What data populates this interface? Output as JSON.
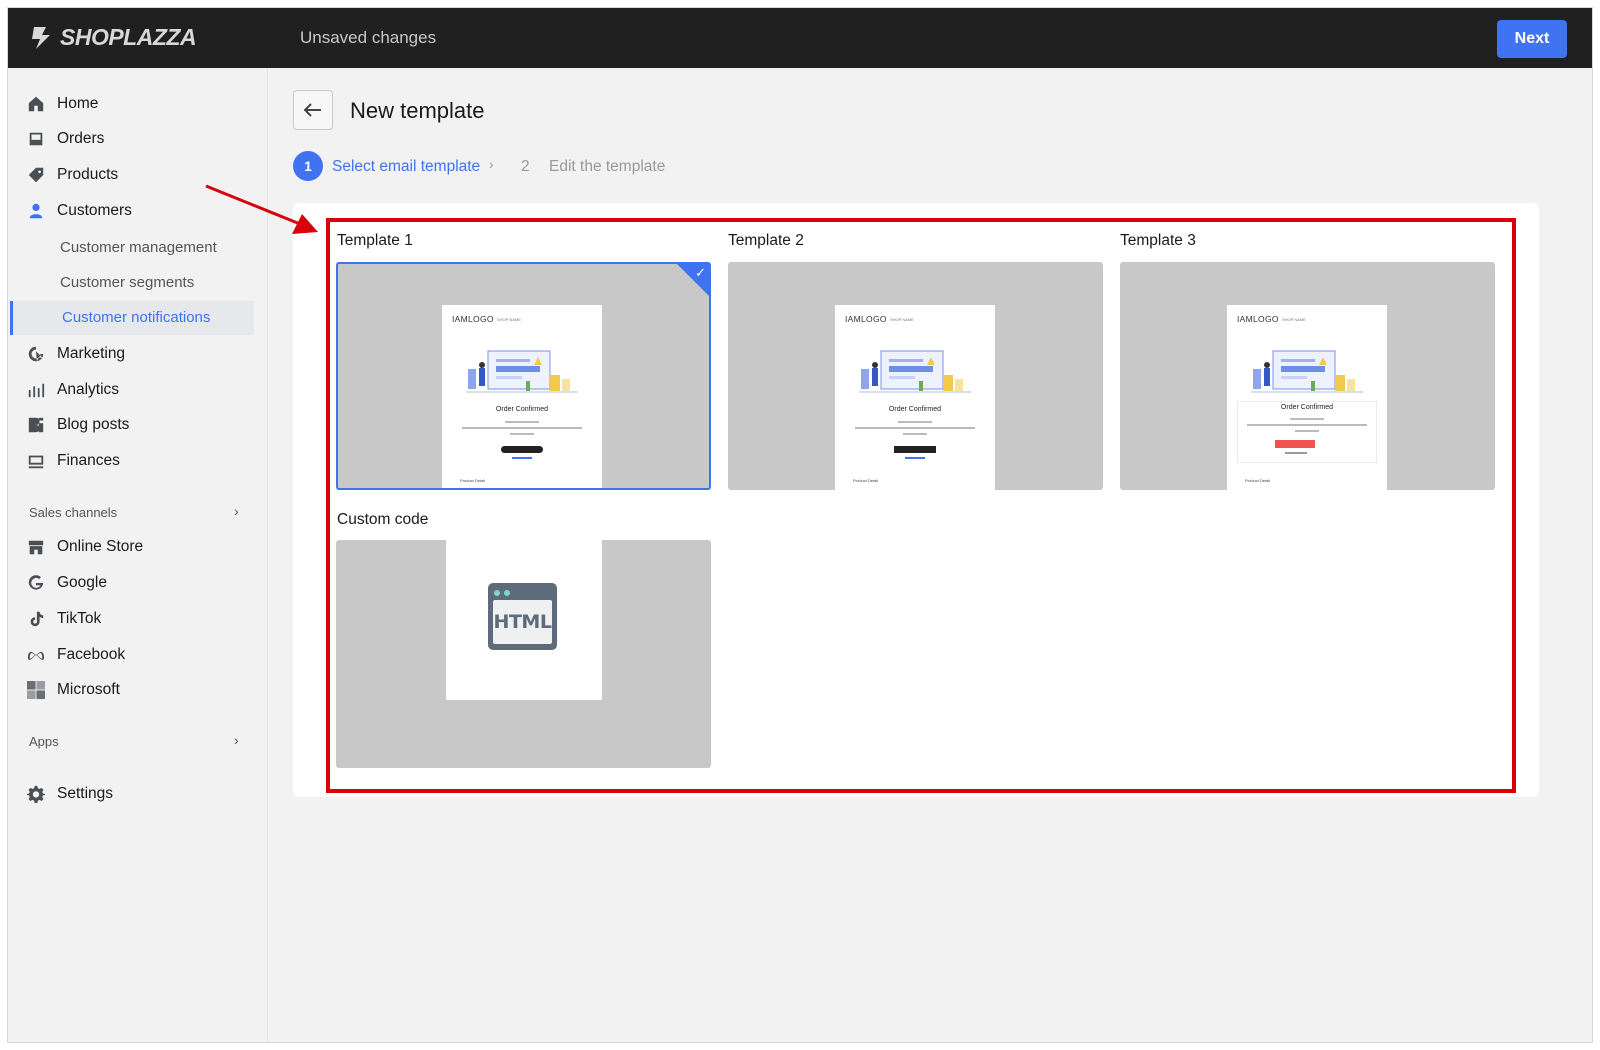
{
  "topbar": {
    "logo_text": "SHOPLAZZA",
    "status": "Unsaved changes",
    "next_label": "Next"
  },
  "sidebar": {
    "items": [
      {
        "label": "Home",
        "icon": "home-icon"
      },
      {
        "label": "Orders",
        "icon": "orders-icon"
      },
      {
        "label": "Products",
        "icon": "tag-icon"
      },
      {
        "label": "Customers",
        "icon": "person-icon"
      }
    ],
    "customer_sub": [
      {
        "label": "Customer management"
      },
      {
        "label": "Customer segments"
      },
      {
        "label": "Customer notifications",
        "active": true
      }
    ],
    "items2": [
      {
        "label": "Marketing",
        "icon": "marketing-icon"
      },
      {
        "label": "Analytics",
        "icon": "analytics-icon"
      },
      {
        "label": "Blog posts",
        "icon": "blog-icon"
      },
      {
        "label": "Finances",
        "icon": "finances-icon"
      }
    ],
    "sales_channels_label": "Sales channels",
    "channels": [
      {
        "label": "Online Store",
        "icon": "store-icon"
      },
      {
        "label": "Google",
        "icon": "google-icon"
      },
      {
        "label": "TikTok",
        "icon": "tiktok-icon"
      },
      {
        "label": "Facebook",
        "icon": "meta-icon"
      },
      {
        "label": "Microsoft",
        "icon": "microsoft-icon"
      }
    ],
    "apps_label": "Apps",
    "settings_label": "Settings"
  },
  "main": {
    "title": "New template",
    "steps": [
      {
        "number": "1",
        "label": "Select email template",
        "active": true
      },
      {
        "number": "2",
        "label": "Edit the template",
        "active": false
      }
    ],
    "templates": [
      {
        "label": "Template 1",
        "selected": true
      },
      {
        "label": "Template 2",
        "selected": false
      },
      {
        "label": "Template 3",
        "selected": false
      }
    ],
    "custom_code": {
      "label": "Custom code",
      "icon_text": "HTML"
    },
    "email_preview": {
      "logo": "IAMLOGO",
      "heading": "Order Confirmed"
    }
  },
  "colors": {
    "accent": "#3f73f1",
    "highlight": "#d8000c",
    "topbar": "#202020"
  }
}
